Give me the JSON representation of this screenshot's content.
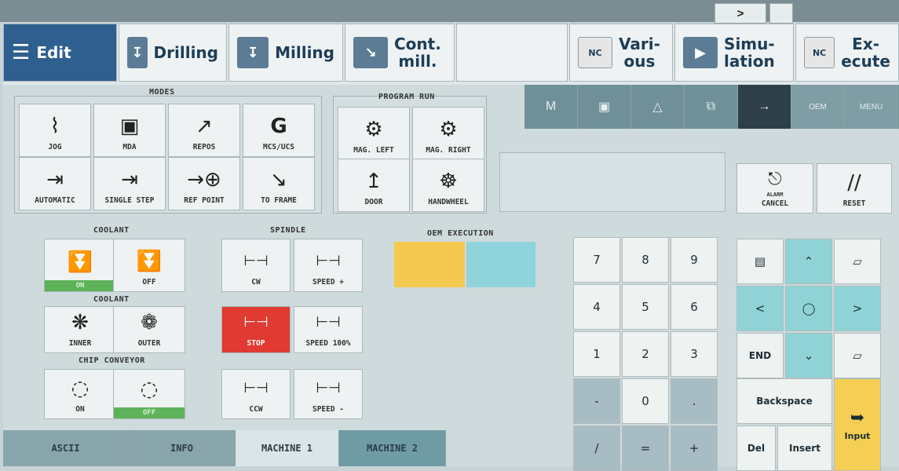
{
  "topbar": {
    "more_label": ">"
  },
  "softkeys": [
    {
      "label": "Edit"
    },
    {
      "label": "Drilling"
    },
    {
      "label": "Milling"
    },
    {
      "label_line1": "Cont.",
      "label_line2": "mill."
    },
    {
      "label_line1": "Vari-",
      "label_line2": "ous"
    },
    {
      "label_line1": "Simu-",
      "label_line2": "lation"
    },
    {
      "label_line1": "Ex-",
      "label_line2": "ecute"
    }
  ],
  "nc_badge": "NC",
  "modes": {
    "title": "MODES",
    "buttons": [
      {
        "label": "JOG",
        "glyph": "⌇"
      },
      {
        "label": "MDA",
        "glyph": "▣"
      },
      {
        "label": "REPOS",
        "glyph": "↗"
      },
      {
        "label": "MCS/UCS",
        "glyph": "G"
      },
      {
        "label": "AUTOMATIC",
        "glyph": "⇥"
      },
      {
        "label": "SINGLE STEP",
        "glyph": "⇥"
      },
      {
        "label": "REF POINT",
        "glyph": "→⊕"
      },
      {
        "label": "TO FRAME",
        "glyph": "↘"
      }
    ]
  },
  "program_run": {
    "title": "PROGRAM RUN",
    "buttons": [
      {
        "label": "MAG. LEFT",
        "glyph": "⚙"
      },
      {
        "label": "MAG. RIGHT",
        "glyph": "⚙"
      },
      {
        "label": "DOOR",
        "glyph": "↥"
      },
      {
        "label": "HANDWHEEL",
        "glyph": "☸"
      }
    ]
  },
  "machine_tabs": [
    {
      "label": "M"
    },
    {
      "label": "▣"
    },
    {
      "label": "△"
    },
    {
      "label": "⧉"
    },
    {
      "label": "→"
    },
    {
      "label": "OEM"
    },
    {
      "label": "MENU"
    }
  ],
  "alarm": {
    "cancel_label": "CANCEL",
    "reset_label": "RESET",
    "alarm_text": "ALARM"
  },
  "coolant": {
    "title": "COOLANT",
    "on_label": "ON",
    "off_label": "OFF"
  },
  "coolant2": {
    "title": "COOLANT",
    "inner_label": "INNER",
    "outer_label": "OUTER"
  },
  "chip_conveyor": {
    "title": "CHIP CONVEYOR",
    "on_label": "ON",
    "off_label": "OFF"
  },
  "spindle": {
    "title": "SPINDLE",
    "cw_label": "CW",
    "speed_plus_label": "SPEED +",
    "stop_label": "STOP",
    "speed100_label": "SPEED 100%",
    "ccw_label": "CCW",
    "speed_minus_label": "SPEED -"
  },
  "oem_execution": {
    "title": "OEM EXECUTION"
  },
  "numpad": [
    "7",
    "8",
    "9",
    "4",
    "5",
    "6",
    "1",
    "2",
    "3",
    "-",
    "0",
    ".",
    "/",
    "=",
    "+"
  ],
  "nav": {
    "end_label": "END",
    "backspace_label": "Backspace",
    "del_label": "Del",
    "insert_label": "Insert",
    "input_label": "Input"
  },
  "bottom_tabs": [
    {
      "label": "ASCII"
    },
    {
      "label": "INFO"
    },
    {
      "label": "MACHINE 1"
    },
    {
      "label": "MACHINE 2"
    }
  ],
  "colors": {
    "accent": "#2f5f8f",
    "on_green": "#5eb25a",
    "stop_red": "#e03a32",
    "oem_yellow": "#f5c84f",
    "oem_cyan": "#8fd3dc"
  }
}
